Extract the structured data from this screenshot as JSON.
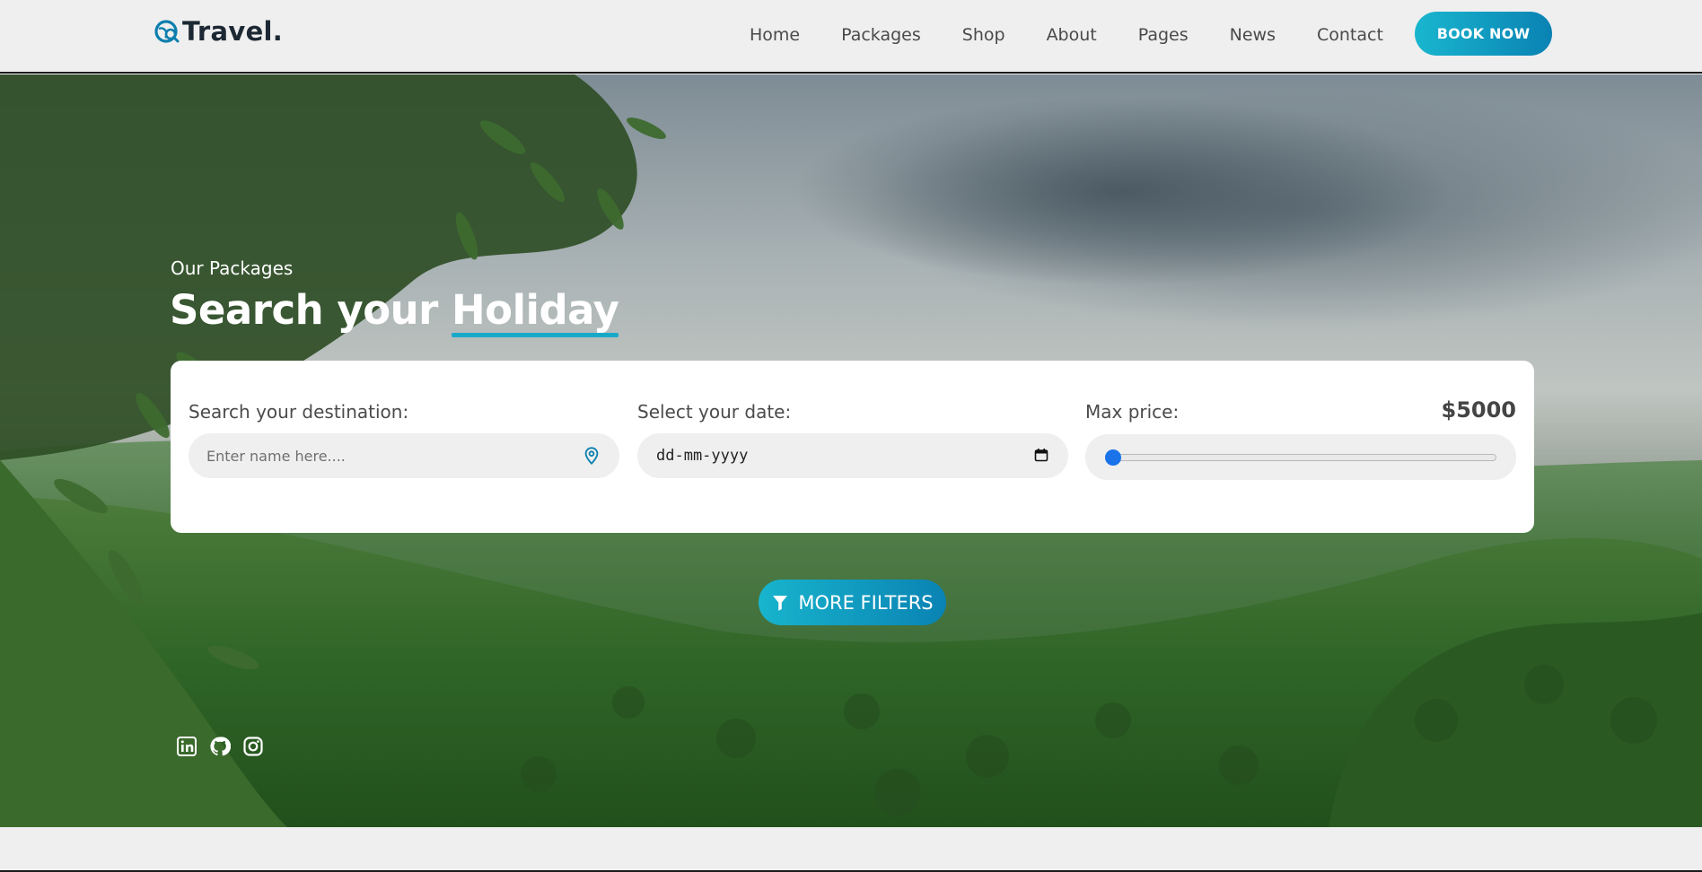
{
  "brand": {
    "name": "Travel.",
    "logo_icon": "globe-search-icon"
  },
  "nav": {
    "items": [
      {
        "label": "Home"
      },
      {
        "label": "Packages"
      },
      {
        "label": "Shop"
      },
      {
        "label": "About"
      },
      {
        "label": "Pages"
      },
      {
        "label": "News"
      },
      {
        "label": "Contact"
      }
    ],
    "cta_label": "BOOK NOW"
  },
  "hero": {
    "subtitle": "Our Packages",
    "title_start": "Search your ",
    "title_accent": "Holiday"
  },
  "search": {
    "destination": {
      "label": "Search your destination:",
      "placeholder": "Enter name here....",
      "icon": "location-pin-icon"
    },
    "date": {
      "label": "Select your date:",
      "value": "dd-mm-yyyy",
      "icon": "calendar-icon"
    },
    "price": {
      "label": "Max price:",
      "value_text": "$5000",
      "slider_fraction": 0.0
    },
    "more_filters_label": "MORE FILTERS",
    "more_filters_icon": "filter-icon"
  },
  "social": [
    {
      "name": "linkedin-icon"
    },
    {
      "name": "github-icon"
    },
    {
      "name": "instagram-icon"
    }
  ],
  "colors": {
    "accent": "#18a9c9",
    "accent_dark": "#0a82b3",
    "slider_thumb": "#1a73e8"
  }
}
